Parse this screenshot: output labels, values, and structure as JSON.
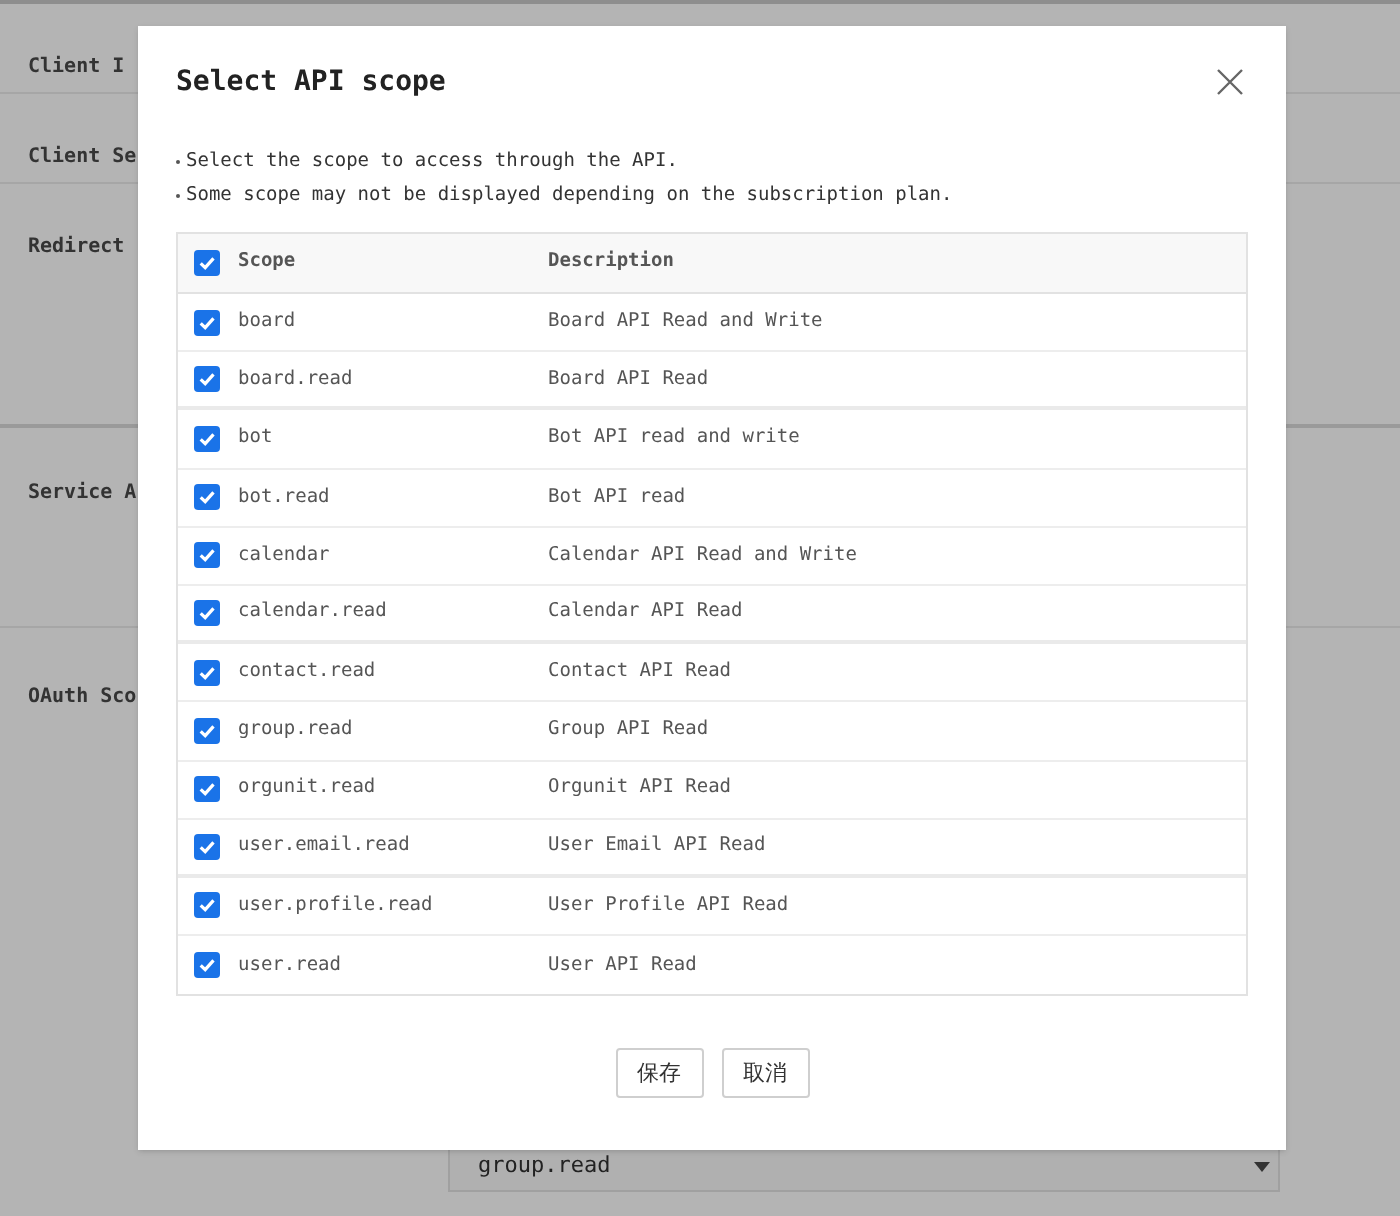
{
  "background": {
    "fields": [
      {
        "label": "Client I"
      },
      {
        "label": "Client Se"
      },
      {
        "label": "Redirect"
      },
      {
        "label": "Service A"
      },
      {
        "label": "OAuth Sco"
      }
    ],
    "scope_select": {
      "value": "group.read"
    }
  },
  "dialog": {
    "title": "Select API scope",
    "notes": [
      "Select the scope to access through the API.",
      "Some scope may not be displayed depending on the subscription plan."
    ],
    "table": {
      "columns": [
        "Scope",
        "Description"
      ],
      "all_checked": true,
      "rows": [
        {
          "scope": "board",
          "description": "Board API Read and Write",
          "checked": true
        },
        {
          "scope": "board.read",
          "description": "Board API Read",
          "checked": true
        },
        {
          "scope": "bot",
          "description": "Bot API read and write",
          "checked": true
        },
        {
          "scope": "bot.read",
          "description": "Bot API read",
          "checked": true
        },
        {
          "scope": "calendar",
          "description": "Calendar API Read and Write",
          "checked": true
        },
        {
          "scope": "calendar.read",
          "description": "Calendar API Read",
          "checked": true
        },
        {
          "scope": "contact.read",
          "description": "Contact API Read",
          "checked": true
        },
        {
          "scope": "group.read",
          "description": "Group API Read",
          "checked": true
        },
        {
          "scope": "orgunit.read",
          "description": "Orgunit API Read",
          "checked": true
        },
        {
          "scope": "user.email.read",
          "description": "User Email API Read",
          "checked": true
        },
        {
          "scope": "user.profile.read",
          "description": "User Profile API Read",
          "checked": true
        },
        {
          "scope": "user.read",
          "description": "User API Read",
          "checked": true
        }
      ]
    },
    "buttons": [
      "保存",
      "取消"
    ]
  }
}
